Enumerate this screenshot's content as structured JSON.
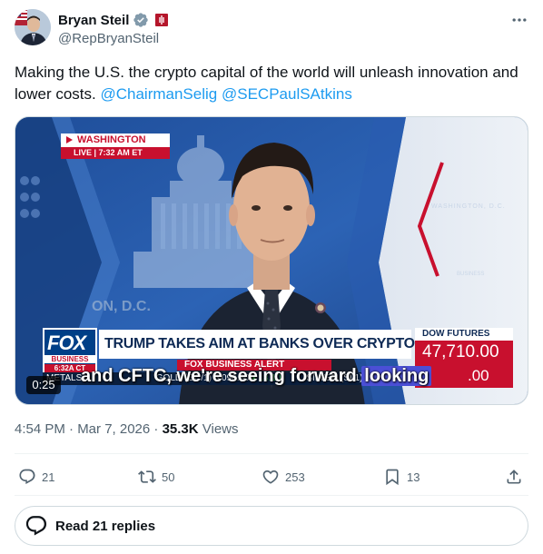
{
  "author": {
    "name": "Bryan Steil",
    "handle": "@RepBryanSteil"
  },
  "tweet": {
    "text_before": "Making the U.S. the crypto capital of the world will unleash innovation and lower costs. ",
    "mentions": [
      "@ChairmanSelig",
      "@SECPaulSAtkins"
    ]
  },
  "media": {
    "location": "WASHINGTON",
    "live_time": "LIVE | 7:32 AM ET",
    "studio_text": "WASHINGTON, D.C.",
    "studio_text2": "BUSINESS",
    "dc_text": "ON, D.C.",
    "logo_fox": "FOX",
    "logo_business": "BUSINESS",
    "logo_time": "6:32A CT",
    "headline": "TRUMP TAKES AIM AT BANKS OVER CRYPTO BILL TALKS",
    "alert": "FOX BUSINESS ALERT",
    "ticker": [
      "METALS",
      "GOLD (GC/1) 5,096.80",
      "▲18.10",
      "SILVER (SI/1)"
    ],
    "dow_label": "DOW FUTURES",
    "dow_value": "47,710.00",
    "dow_change": ".00",
    "caption_plain": "and CFTC, we're seeing forward ",
    "caption_highlight": "looking",
    "duration": "0:25"
  },
  "meta": {
    "time": "4:54 PM · Mar 7, 2026 · ",
    "views_count": "35.3K",
    "views_label": " Views"
  },
  "actions": {
    "replies": "21",
    "reposts": "50",
    "likes": "253",
    "bookmarks": "13"
  },
  "read_replies": "Read 21 replies",
  "colors": {
    "accent": "#1d9bf0",
    "text_secondary": "#536471",
    "fox_red": "#c8102e",
    "fox_blue": "#003f87"
  }
}
